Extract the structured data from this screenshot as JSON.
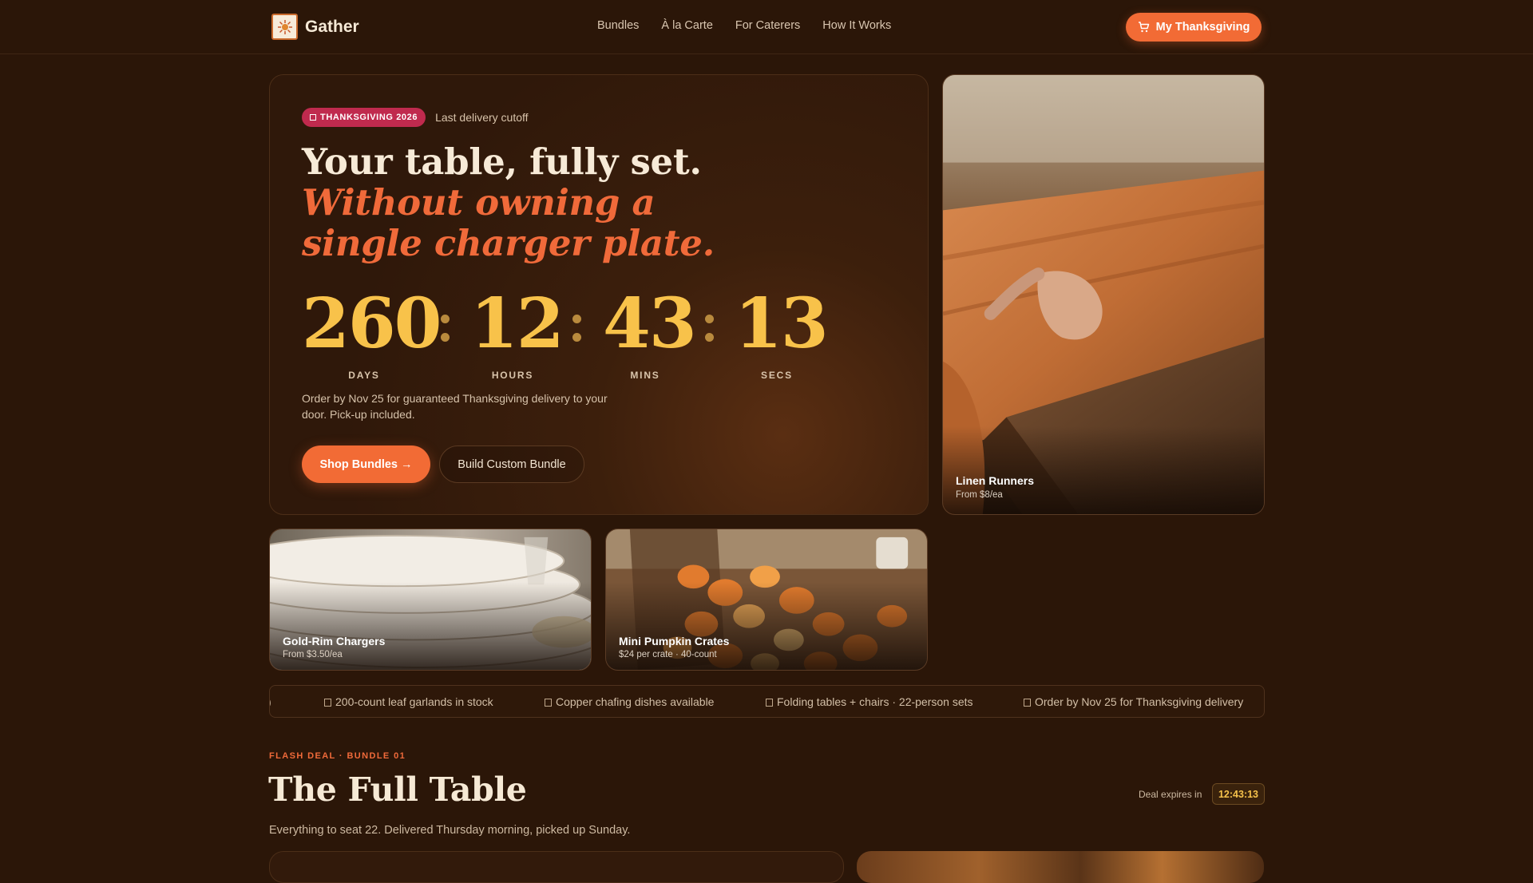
{
  "header": {
    "brand": "Gather",
    "nav": [
      "Bundles",
      "À la Carte",
      "For Caterers",
      "How It Works"
    ],
    "cart_label": "My Thanksgiving"
  },
  "hero": {
    "badge": "THANKSGIVING 2026",
    "badge_note": "Last delivery cutoff",
    "title_line1": "Your table, fully set.",
    "title_line2": "Without owning a single charger plate.",
    "countdown": [
      {
        "value": "260",
        "label": "DAYS"
      },
      {
        "value": "12",
        "label": "HOURS"
      },
      {
        "value": "43",
        "label": "MINS"
      },
      {
        "value": "13",
        "label": "SECS"
      }
    ],
    "description": "Order by Nov 25 for guaranteed Thanksgiving delivery to your door. Pick-up included.",
    "primary_cta": "Shop Bundles →",
    "secondary_cta": "Build Custom Bundle"
  },
  "products": [
    {
      "title": "Linen Runners",
      "subtitle": "From $8/ea"
    },
    {
      "title": "Gold-Rim Chargers",
      "subtitle": "From $3.50/ea"
    },
    {
      "title": "Mini Pumpkin Crates",
      "subtitle": "$24 per crate · 40-count"
    }
  ],
  "ticker": [
    "200-count leaf garlands in stock",
    "Copper chafing dishes available",
    "Folding tables + chairs · 22-person sets",
    "Order by Nov 25 for Thanksgiving delivery"
  ],
  "flash_deal": {
    "eyebrow": "FLASH DEAL · BUNDLE 01",
    "title": "The Full Table",
    "description": "Everything to seat 22. Delivered Thursday morning, picked up Sunday.",
    "expires_label": "Deal expires in",
    "timer": "12:43:13"
  },
  "colors": {
    "background": "#2b1608",
    "accent": "#f26b35",
    "countdown": "#f8c24a",
    "badge": "#c02a4e"
  },
  "icons": [
    "brand-logo-icon",
    "cart-icon"
  ]
}
